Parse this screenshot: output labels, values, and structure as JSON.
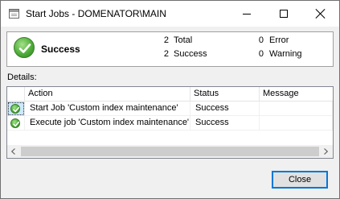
{
  "window": {
    "title": "Start Jobs - DOMENATOR\\MAIN",
    "icon": "app-window-icon",
    "controls": {
      "minimize": "minimize-icon",
      "maximize": "maximize-icon",
      "close": "close-icon"
    }
  },
  "summary": {
    "status_icon": "success-check-icon",
    "status_label": "Success",
    "total_count": "2",
    "total_label": "Total",
    "success_count": "2",
    "success_label": "Success",
    "error_count": "0",
    "error_label": "Error",
    "warning_count": "0",
    "warning_label": "Warning"
  },
  "details": {
    "label": "Details:",
    "columns": {
      "action": "Action",
      "status": "Status",
      "message": "Message"
    },
    "rows": [
      {
        "icon": "success-check-icon",
        "action": "Start Job 'Custom index maintenance'",
        "status": "Success",
        "message": ""
      },
      {
        "icon": "success-check-icon",
        "action": "Execute job 'Custom index maintenance'",
        "status": "Success",
        "message": ""
      }
    ]
  },
  "footer": {
    "close_label": "Close"
  },
  "colors": {
    "accent": "#0078d7",
    "success": "#4fae3a",
    "window_bg": "#f0f0f0"
  }
}
